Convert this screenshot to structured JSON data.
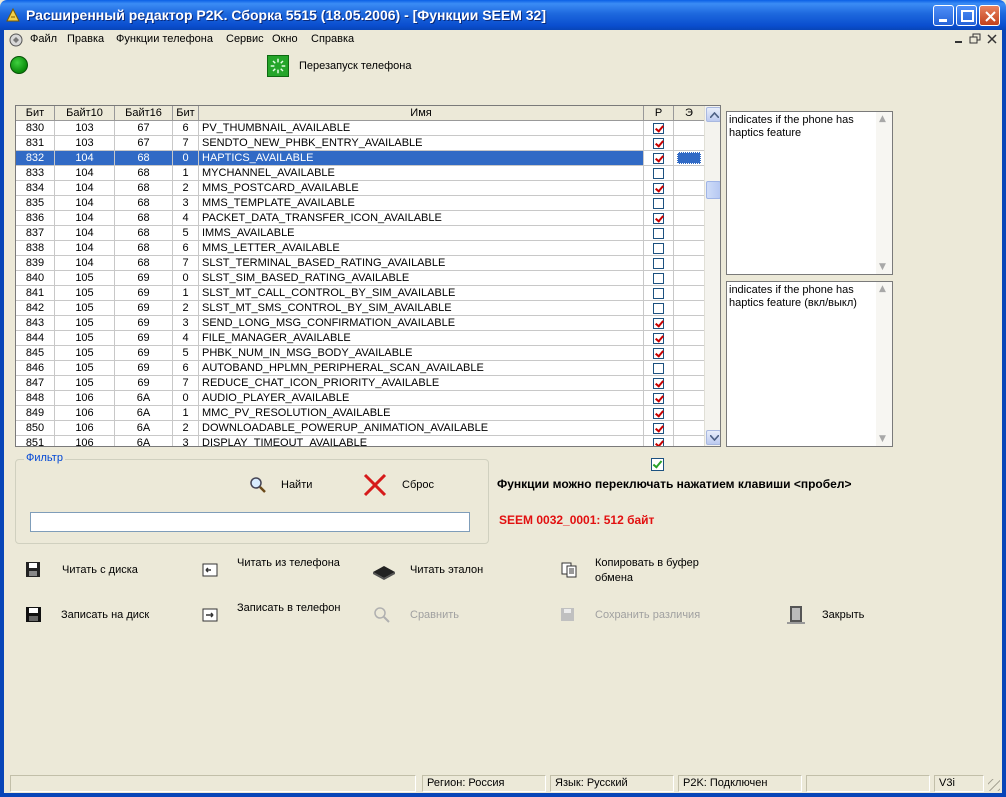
{
  "window": {
    "title": "Расширенный редактор P2K. Сборка 5515 (18.05.2006) - [Функции SEEM 32]"
  },
  "menu": {
    "items": [
      "Файл",
      "Правка",
      "Функции телефона",
      "Сервис",
      "Окно",
      "Справка"
    ]
  },
  "toolbar": {
    "restart_label": "Перезапуск телефона"
  },
  "grid": {
    "headers": [
      "Бит",
      "Байт10",
      "Байт16",
      "Бит",
      "Имя",
      "Р",
      "Э"
    ],
    "selected_index": 2,
    "rows": [
      {
        "bit": "830",
        "b10": "103",
        "b16": "67",
        "bb": "6",
        "name": "PV_THUMBNAIL_AVAILABLE",
        "r": true
      },
      {
        "bit": "831",
        "b10": "103",
        "b16": "67",
        "bb": "7",
        "name": "SENDTO_NEW_PHBK_ENTRY_AVAILABLE",
        "r": true
      },
      {
        "bit": "832",
        "b10": "104",
        "b16": "68",
        "bb": "0",
        "name": "HAPTICS_AVAILABLE",
        "r": true
      },
      {
        "bit": "833",
        "b10": "104",
        "b16": "68",
        "bb": "1",
        "name": "MYCHANNEL_AVAILABLE",
        "r": false
      },
      {
        "bit": "834",
        "b10": "104",
        "b16": "68",
        "bb": "2",
        "name": "MMS_POSTCARD_AVAILABLE",
        "r": true
      },
      {
        "bit": "835",
        "b10": "104",
        "b16": "68",
        "bb": "3",
        "name": "MMS_TEMPLATE_AVAILABLE",
        "r": false
      },
      {
        "bit": "836",
        "b10": "104",
        "b16": "68",
        "bb": "4",
        "name": "PACKET_DATA_TRANSFER_ICON_AVAILABLE",
        "r": true
      },
      {
        "bit": "837",
        "b10": "104",
        "b16": "68",
        "bb": "5",
        "name": "IMMS_AVAILABLE",
        "r": false
      },
      {
        "bit": "838",
        "b10": "104",
        "b16": "68",
        "bb": "6",
        "name": "MMS_LETTER_AVAILABLE",
        "r": false
      },
      {
        "bit": "839",
        "b10": "104",
        "b16": "68",
        "bb": "7",
        "name": "SLST_TERMINAL_BASED_RATING_AVAILABLE",
        "r": false
      },
      {
        "bit": "840",
        "b10": "105",
        "b16": "69",
        "bb": "0",
        "name": "SLST_SIM_BASED_RATING_AVAILABLE",
        "r": false
      },
      {
        "bit": "841",
        "b10": "105",
        "b16": "69",
        "bb": "1",
        "name": "SLST_MT_CALL_CONTROL_BY_SIM_AVAILABLE",
        "r": false
      },
      {
        "bit": "842",
        "b10": "105",
        "b16": "69",
        "bb": "2",
        "name": "SLST_MT_SMS_CONTROL_BY_SIM_AVAILABLE",
        "r": false
      },
      {
        "bit": "843",
        "b10": "105",
        "b16": "69",
        "bb": "3",
        "name": "SEND_LONG_MSG_CONFIRMATION_AVAILABLE",
        "r": true
      },
      {
        "bit": "844",
        "b10": "105",
        "b16": "69",
        "bb": "4",
        "name": "FILE_MANAGER_AVAILABLE",
        "r": true
      },
      {
        "bit": "845",
        "b10": "105",
        "b16": "69",
        "bb": "5",
        "name": "PHBK_NUM_IN_MSG_BODY_AVAILABLE",
        "r": true
      },
      {
        "bit": "846",
        "b10": "105",
        "b16": "69",
        "bb": "6",
        "name": "AUTOBAND_HPLMN_PERIPHERAL_SCAN_AVAILABLE",
        "r": false
      },
      {
        "bit": "847",
        "b10": "105",
        "b16": "69",
        "bb": "7",
        "name": "REDUCE_CHAT_ICON_PRIORITY_AVAILABLE",
        "r": true
      },
      {
        "bit": "848",
        "b10": "106",
        "b16": "6A",
        "bb": "0",
        "name": "AUDIO_PLAYER_AVAILABLE",
        "r": true
      },
      {
        "bit": "849",
        "b10": "106",
        "b16": "6A",
        "bb": "1",
        "name": "MMC_PV_RESOLUTION_AVAILABLE",
        "r": true
      },
      {
        "bit": "850",
        "b10": "106",
        "b16": "6A",
        "bb": "2",
        "name": "DOWNLOADABLE_POWERUP_ANIMATION_AVAILABLE",
        "r": true
      },
      {
        "bit": "851",
        "b10": "106",
        "b16": "6A",
        "bb": "3",
        "name": "DISPLAY_TIMEOUT_AVAILABLE",
        "r": true
      }
    ]
  },
  "description": {
    "short": "indicates if the phone has haptics feature",
    "long": "indicates if the phone has haptics feature (вкл/выкл)"
  },
  "filter": {
    "legend": "Фильтр",
    "find_label": "Найти",
    "reset_label": "Сброс",
    "query": ""
  },
  "options": {
    "space_toggle_checked": true,
    "space_toggle_hint": "Функции можно переключать нажатием клавиши <пробел>",
    "seem_info": "SEEM 0032_0001: 512 байт"
  },
  "actions": {
    "read_disk": "Читать с диска",
    "read_phone": "Читать из телефона",
    "read_reference": "Читать эталон",
    "copy_clipboard": "Копировать в буфер обмена",
    "write_disk": "Записать на диск",
    "write_phone": "Записать в телефон",
    "compare": "Сравнить",
    "save_diff": "Сохранить различия",
    "close": "Закрыть"
  },
  "statusbar": {
    "region": "Регион: Россия",
    "language": "Язык: Русский",
    "p2k": "P2K: Подключен",
    "version": "V3i"
  }
}
